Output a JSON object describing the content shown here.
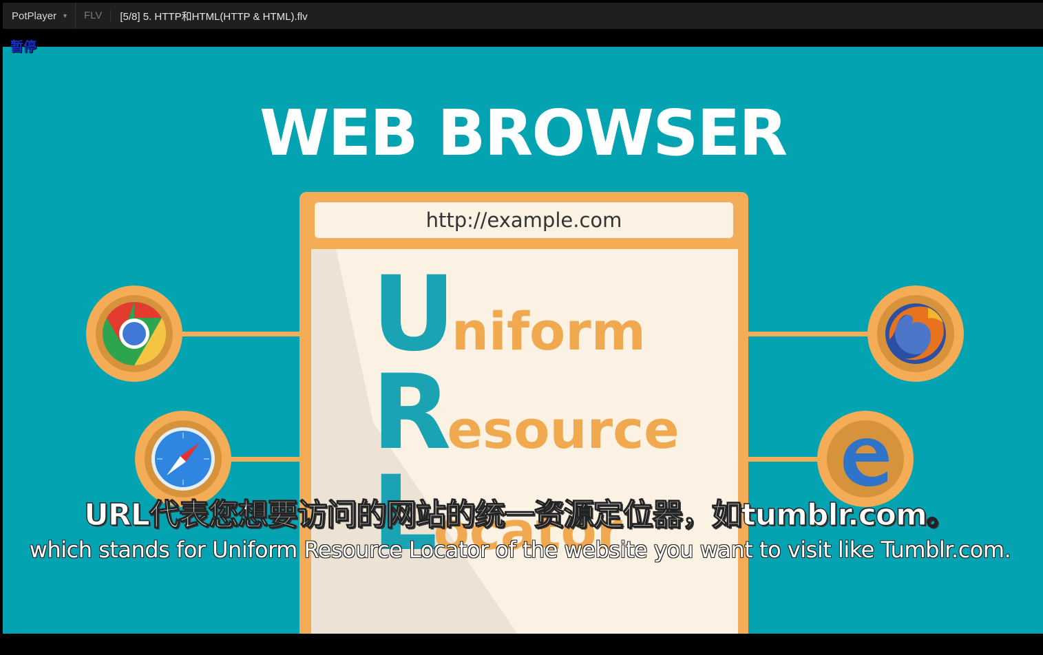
{
  "window": {
    "app_name": "PotPlayer",
    "format": "FLV",
    "file_title": "[5/8] 5. HTTP和HTML(HTTP & HTML).flv"
  },
  "osd": {
    "status": "暂停"
  },
  "video": {
    "headline": "WEB BROWSER",
    "url_bar": "http://example.com",
    "acronym": [
      {
        "initial": "U",
        "rest": "niform"
      },
      {
        "initial": "R",
        "rest": "esource"
      },
      {
        "initial": "L",
        "rest": "ocator"
      }
    ],
    "icons": [
      "chrome-icon",
      "safari-icon",
      "firefox-icon",
      "edge-icon"
    ]
  },
  "subtitles": {
    "cn": "URL代表您想要访问的网站的统一资源定位器，如tumblr.com。",
    "en": "which stands for Uniform Resource Locator of the website you want to visit like Tumblr.com."
  },
  "colors": {
    "video_bg": "#04a3b2",
    "accent_orange": "#f4ad56",
    "acronym_teal": "#1aa3b3",
    "osd_blue": "#1530c8"
  }
}
